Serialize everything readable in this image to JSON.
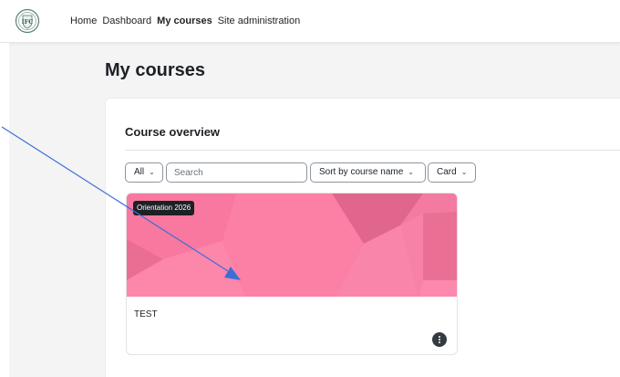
{
  "navbar": {
    "logo_icon": "school-crest-icon",
    "links": [
      {
        "label": "Home",
        "active": false
      },
      {
        "label": "Dashboard",
        "active": false
      },
      {
        "label": "My courses",
        "active": true
      },
      {
        "label": "Site administration",
        "active": false
      }
    ]
  },
  "page": {
    "title": "My courses"
  },
  "course_overview": {
    "title": "Course overview",
    "filter": {
      "selected": "All"
    },
    "search": {
      "placeholder": "Search",
      "value": ""
    },
    "sort": {
      "selected": "Sort by course name"
    },
    "view": {
      "selected": "Card"
    },
    "courses": [
      {
        "category_badge": "Orientation 2026",
        "name": "TEST",
        "image_color": "#fb7ba2",
        "menu_icon": "three-dots-vertical-icon"
      }
    ]
  },
  "annotation": {
    "arrow_color": "#3b6fd8",
    "arrow_icon": "arrow-pointer-icon"
  }
}
